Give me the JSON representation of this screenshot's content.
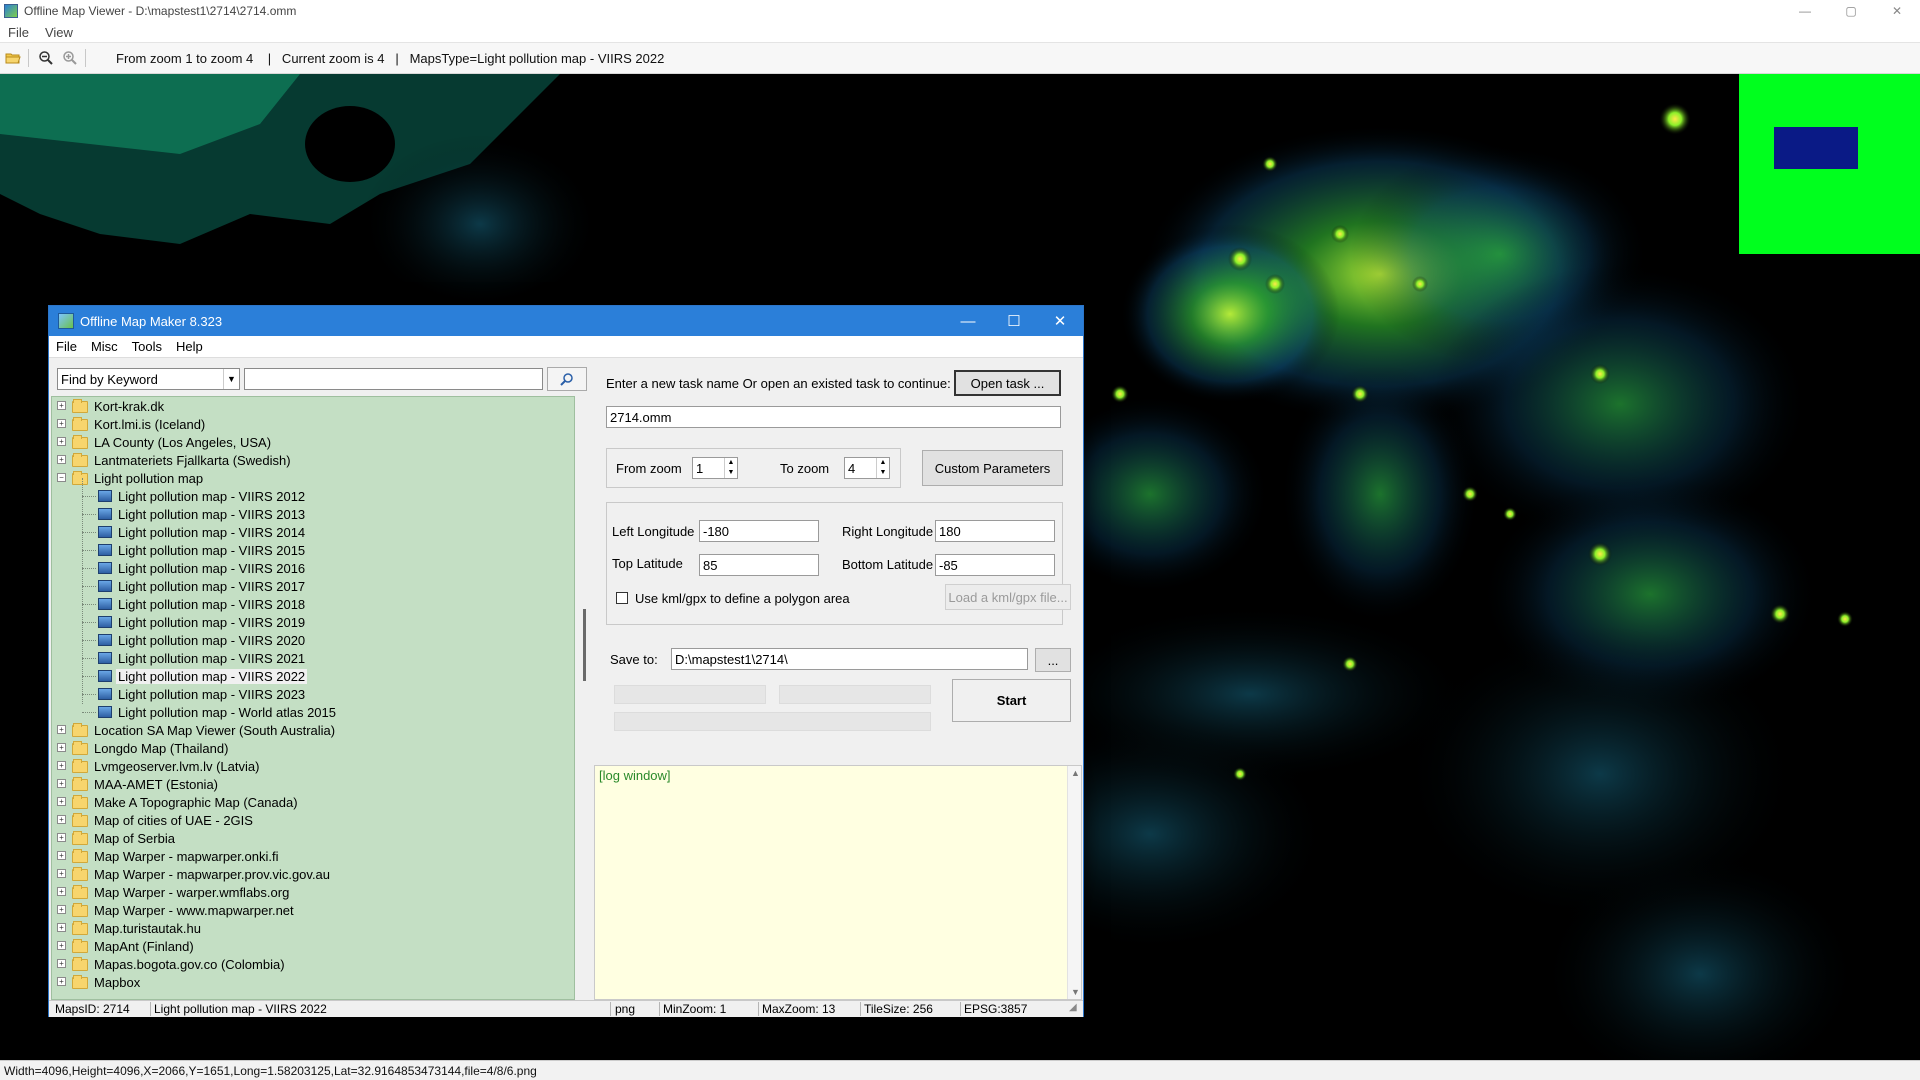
{
  "window": {
    "title": "Offline Map Viewer - D:\\mapstest1\\2714\\2714.omm",
    "menu": [
      "File",
      "View"
    ],
    "controls": {
      "minimize": "—",
      "restore": "▢",
      "close": "✕"
    }
  },
  "toolbar": {
    "icons": [
      "folder-open-icon",
      "zoom-out-icon",
      "zoom-in-icon"
    ],
    "info": "From zoom 1 to zoom 4    |   Current zoom is 4   |   MapsType=Light pollution map - VIIRS 2022"
  },
  "statusbar": {
    "text": "Width=4096,Height=4096,X=2066,Y=1651,Long=1.58203125,Lat=32.9164853473144,file=4/8/6.png"
  },
  "colors": {
    "accent": "#2b7fd9",
    "tree_bg": "#c4dfc4",
    "log_bg": "#ffffe1",
    "minimap_green": "#00ff1e",
    "minimap_blue": "#0a1a86"
  },
  "dialog": {
    "title": "Offline Map Maker 8.323",
    "controls": {
      "minimize": "—",
      "maximize": "☐",
      "close": "✕"
    },
    "menu": [
      "File",
      "Misc",
      "Tools",
      "Help"
    ],
    "search": {
      "mode": "Find by Keyword",
      "value": ""
    },
    "tree": [
      {
        "label": "Kort-krak.dk",
        "type": "folder",
        "expanded": false
      },
      {
        "label": "Kort.lmi.is (Iceland)",
        "type": "folder",
        "expanded": false
      },
      {
        "label": "LA County (Los Angeles, USA)",
        "type": "folder",
        "expanded": false
      },
      {
        "label": "Lantmateriets Fjallkarta (Swedish)",
        "type": "folder",
        "expanded": false
      },
      {
        "label": "Light pollution map",
        "type": "folder",
        "expanded": true
      },
      {
        "label": "Light pollution map - VIIRS 2012",
        "type": "map"
      },
      {
        "label": "Light pollution map - VIIRS 2013",
        "type": "map"
      },
      {
        "label": "Light pollution map - VIIRS 2014",
        "type": "map"
      },
      {
        "label": "Light pollution map - VIIRS 2015",
        "type": "map"
      },
      {
        "label": "Light pollution map - VIIRS 2016",
        "type": "map"
      },
      {
        "label": "Light pollution map - VIIRS 2017",
        "type": "map"
      },
      {
        "label": "Light pollution map - VIIRS 2018",
        "type": "map"
      },
      {
        "label": "Light pollution map - VIIRS 2019",
        "type": "map"
      },
      {
        "label": "Light pollution map - VIIRS 2020",
        "type": "map"
      },
      {
        "label": "Light pollution map - VIIRS 2021",
        "type": "map"
      },
      {
        "label": "Light pollution map - VIIRS 2022",
        "type": "map",
        "selected": true
      },
      {
        "label": "Light pollution map - VIIRS 2023",
        "type": "map"
      },
      {
        "label": "Light pollution map - World atlas 2015",
        "type": "map"
      },
      {
        "label": "Location SA Map Viewer (South Australia)",
        "type": "folder",
        "expanded": false
      },
      {
        "label": "Longdo Map (Thailand)",
        "type": "folder",
        "expanded": false
      },
      {
        "label": "Lvmgeoserver.lvm.lv (Latvia)",
        "type": "folder",
        "expanded": false
      },
      {
        "label": "MAA-AMET (Estonia)",
        "type": "folder",
        "expanded": false
      },
      {
        "label": "Make A Topographic Map (Canada)",
        "type": "folder",
        "expanded": false
      },
      {
        "label": "Map of cities of UAE - 2GIS",
        "type": "folder",
        "expanded": false
      },
      {
        "label": "Map of Serbia",
        "type": "folder",
        "expanded": false
      },
      {
        "label": "Map Warper - mapwarper.onki.fi",
        "type": "folder",
        "expanded": false
      },
      {
        "label": "Map Warper - mapwarper.prov.vic.gov.au",
        "type": "folder",
        "expanded": false
      },
      {
        "label": "Map Warper - warper.wmflabs.org",
        "type": "folder",
        "expanded": false
      },
      {
        "label": "Map Warper - www.mapwarper.net",
        "type": "folder",
        "expanded": false
      },
      {
        "label": "Map.turistautak.hu",
        "type": "folder",
        "expanded": false
      },
      {
        "label": "MapAnt (Finland)",
        "type": "folder",
        "expanded": false
      },
      {
        "label": "Mapas.bogota.gov.co (Colombia)",
        "type": "folder",
        "expanded": false
      },
      {
        "label": "Mapbox",
        "type": "folder",
        "expanded": false
      }
    ],
    "task": {
      "prompt": "Enter a new task name Or open an existed task to continue:",
      "open_button": "Open task ...",
      "name_value": "2714.omm"
    },
    "zoom": {
      "from_label": "From zoom",
      "from_value": "1",
      "to_label": "To zoom",
      "to_value": "4",
      "custom_button": "Custom Parameters"
    },
    "bounds": {
      "left_label": "Left Longitude",
      "left_value": "-180",
      "right_label": "Right Longitude",
      "right_value": "180",
      "top_label": "Top Latitude",
      "top_value": "85",
      "bottom_label": "Bottom Latitude",
      "bottom_value": "-85",
      "kml_checkbox_label": "Use kml/gpx to define a polygon area",
      "kml_checked": false,
      "kml_button": "Load a kml/gpx file..."
    },
    "save": {
      "label": "Save to:",
      "value": "D:\\mapstest1\\2714\\",
      "browse_button": "...",
      "start_button": "Start"
    },
    "log": {
      "text": "[log window]"
    },
    "status": {
      "maps_id": "MapsID: 2714",
      "map_name": "Light pollution map - VIIRS 2022",
      "format": "png",
      "min_zoom": "MinZoom: 1",
      "max_zoom": "MaxZoom: 13",
      "tile_size": "TileSize: 256",
      "epsg": "EPSG:3857"
    }
  }
}
